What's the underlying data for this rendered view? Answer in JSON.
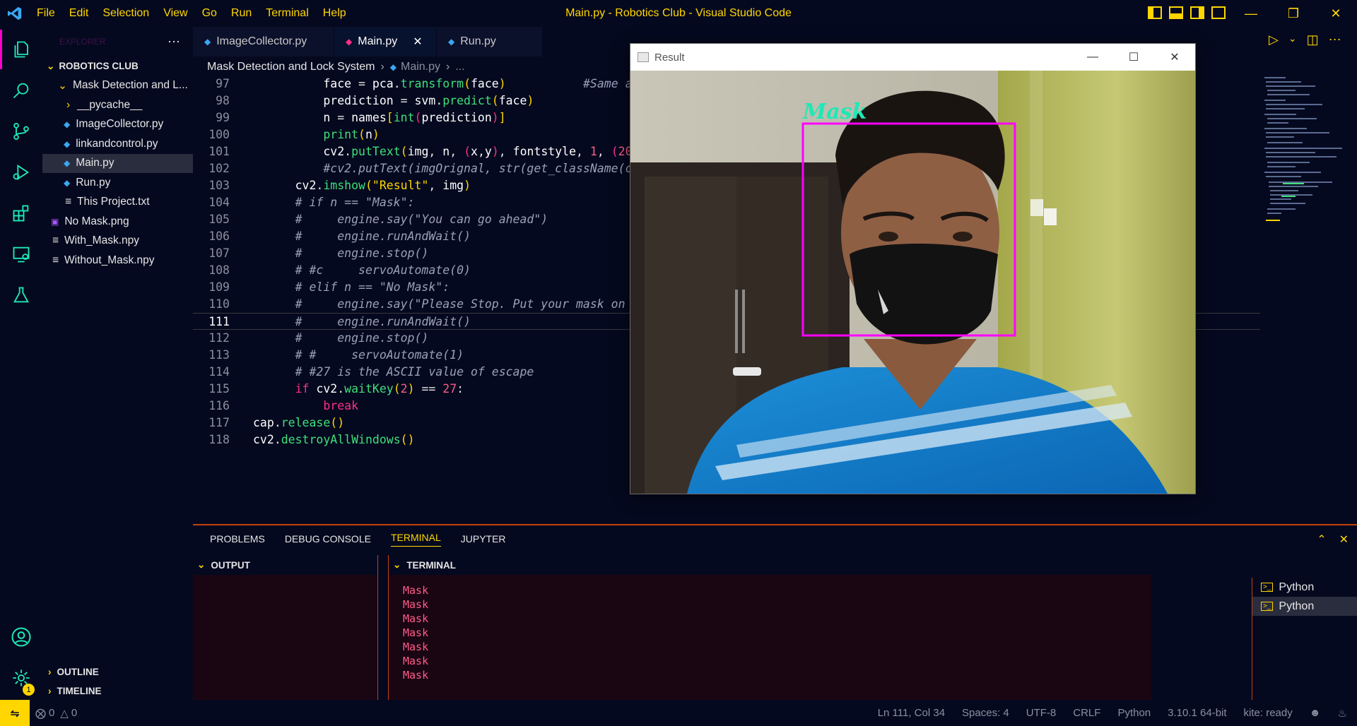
{
  "titlebar": {
    "title": "Main.py - Robotics Club - Visual Studio Code",
    "menu": [
      "File",
      "Edit",
      "Selection",
      "View",
      "Go",
      "Run",
      "Terminal",
      "Help"
    ]
  },
  "sidebar": {
    "header": "EXPLORER",
    "root": "ROBOTICS CLUB",
    "folder": "Mask Detection and L...",
    "items": [
      {
        "label": "__pycache__"
      },
      {
        "label": "ImageCollector.py"
      },
      {
        "label": "linkandcontrol.py"
      },
      {
        "label": "Main.py"
      },
      {
        "label": "Run.py"
      },
      {
        "label": "This Project.txt"
      },
      {
        "label": "No Mask.png"
      },
      {
        "label": "With_Mask.npy"
      },
      {
        "label": "Without_Mask.npy"
      }
    ],
    "outline": "OUTLINE",
    "timeline": "TIMELINE",
    "settings_badge": "1"
  },
  "tabs": [
    {
      "label": "ImageCollector.py"
    },
    {
      "label": "Main.py"
    },
    {
      "label": "Run.py"
    }
  ],
  "breadcrumb": {
    "folder": "Mask Detection and Lock System",
    "file": "Main.py",
    "rest": "..."
  },
  "editor": {
    "current_line": "111",
    "lines": [
      {
        "n": "97"
      },
      {
        "n": "98"
      },
      {
        "n": "99"
      },
      {
        "n": "100"
      },
      {
        "n": "101"
      },
      {
        "n": "102"
      },
      {
        "n": "103"
      },
      {
        "n": "104"
      },
      {
        "n": "105"
      },
      {
        "n": "106"
      },
      {
        "n": "107"
      },
      {
        "n": "108"
      },
      {
        "n": "109"
      },
      {
        "n": "110"
      },
      {
        "n": "111"
      },
      {
        "n": "112"
      },
      {
        "n": "113"
      },
      {
        "n": "114"
      },
      {
        "n": "115"
      },
      {
        "n": "116"
      },
      {
        "n": "117"
      },
      {
        "n": "118"
      }
    ]
  },
  "result_window": {
    "title": "Result",
    "overlay_label": "Mask",
    "box_color": "#ff00ff",
    "label_color": "#1de9b6"
  },
  "panel": {
    "tabs": [
      "PROBLEMS",
      "DEBUG CONSOLE",
      "TERMINAL",
      "JUPYTER"
    ],
    "output_header": "OUTPUT",
    "terminal_header": "TERMINAL",
    "terminal_lines": [
      "Mask",
      "Mask",
      "Mask",
      "Mask",
      "Mask",
      "Mask",
      "Mask"
    ],
    "terminals": [
      {
        "label": "Python"
      },
      {
        "label": "Python"
      }
    ]
  },
  "statusbar": {
    "errors": "0",
    "warnings": "0",
    "position": "Ln 111, Col 34",
    "spaces": "Spaces: 4",
    "encoding": "UTF-8",
    "eol": "CRLF",
    "language": "Python",
    "interpreter": "3.10.1 64-bit",
    "kite": "kite: ready"
  },
  "colors": {
    "accent": "#ffd600",
    "pink": "#ff2e88",
    "background": "#05091f"
  }
}
